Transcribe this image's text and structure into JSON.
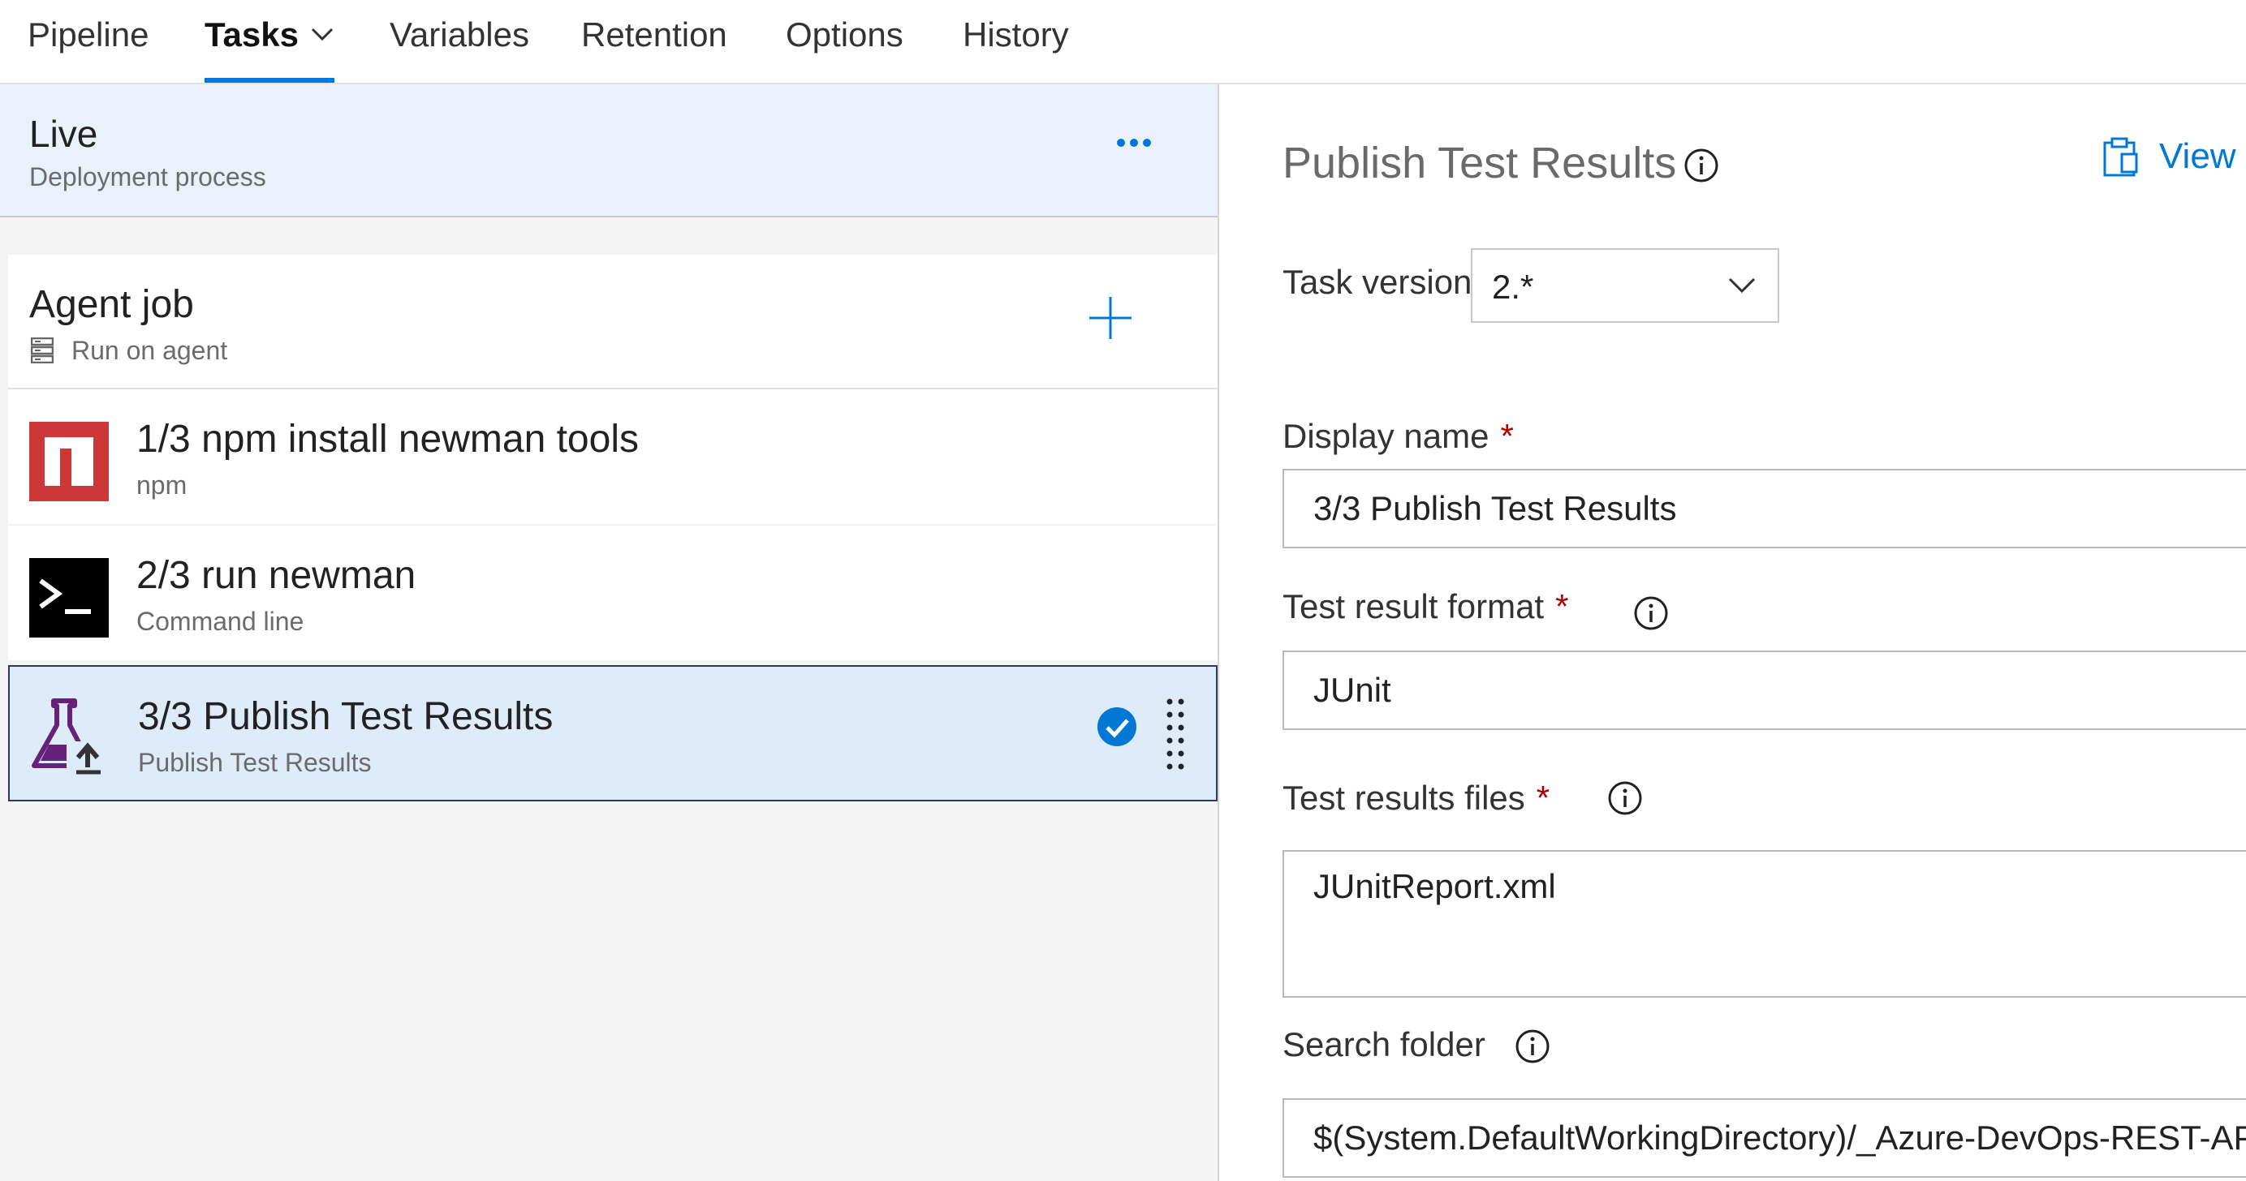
{
  "nav": {
    "tabs": [
      {
        "label": "Pipeline"
      },
      {
        "label": "Tasks"
      },
      {
        "label": "Variables"
      },
      {
        "label": "Retention"
      },
      {
        "label": "Options"
      },
      {
        "label": "History"
      }
    ],
    "active_tab": "Tasks",
    "accent_color": "#0078d4"
  },
  "stage": {
    "title": "Live",
    "subtitle": "Deployment process",
    "more_icon": "ellipsis-icon"
  },
  "agent_job": {
    "title": "Agent job",
    "subtitle": "Run on agent",
    "icon": "server-icon",
    "add_icon": "plus-icon"
  },
  "tasks": [
    {
      "title": "1/3 npm install newman tools",
      "subtitle": "npm",
      "icon": "npm-icon",
      "selected": false
    },
    {
      "title": "2/3 run newman",
      "subtitle": "Command line",
      "icon": "terminal-icon",
      "selected": false
    },
    {
      "title": "3/3 Publish Test Results",
      "subtitle": "Publish Test Results",
      "icon": "flask-upload-icon",
      "selected": true
    }
  ],
  "detail": {
    "title": "Publish Test Results",
    "view_link": "View Y",
    "task_version": {
      "label": "Task version",
      "value": "2.*"
    },
    "display_name": {
      "label": "Display name",
      "required": "*",
      "value": "3/3 Publish Test Results"
    },
    "test_result_format": {
      "label": "Test result format",
      "required": "*",
      "value": "JUnit"
    },
    "test_results_files": {
      "label": "Test results files",
      "required": "*",
      "value": "JUnitReport.xml"
    },
    "search_folder": {
      "label": "Search folder",
      "value": "$(System.DefaultWorkingDirectory)/_Azure-DevOps-REST-API"
    }
  },
  "colors": {
    "stage_bg": "#eaf1fb",
    "selected_bg": "#deecf9",
    "npm_red": "#cb3837",
    "flask_purple": "#68217a",
    "required_red": "#a80000"
  }
}
